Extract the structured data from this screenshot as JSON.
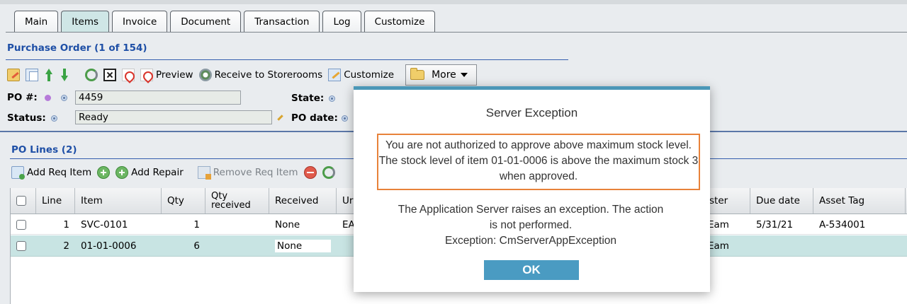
{
  "tabs": [
    {
      "label": "Main"
    },
    {
      "label": "Items",
      "active": true
    },
    {
      "label": "Invoice"
    },
    {
      "label": "Document"
    },
    {
      "label": "Transaction"
    },
    {
      "label": "Log"
    },
    {
      "label": "Customize"
    }
  ],
  "header": {
    "title": "Purchase Order (1 of 154)"
  },
  "toolbar": {
    "preview": "Preview",
    "receive": "Receive to Storerooms",
    "customize": "Customize",
    "more": "More"
  },
  "form": {
    "po_label": "PO #:",
    "po_value": "4459",
    "status_label": "Status:",
    "status_value": "Ready",
    "state_label": "State:",
    "podate_label": "PO date:"
  },
  "lines": {
    "title": "PO Lines (2)",
    "toolbar": {
      "add_req": "Add Req Item",
      "add_repair": "Add Repair",
      "remove_req": "Remove Req Item"
    },
    "columns": {
      "line": "Line",
      "item": "Item",
      "qty": "Qty",
      "qty_received_1": "Qty",
      "qty_received_2": "received",
      "received": "Received",
      "unit": "Ur",
      "requester": "ster",
      "due_date": "Due date",
      "asset_tag": "Asset Tag"
    },
    "rows": [
      {
        "line": "1",
        "item": "SVC-0101",
        "qty": "1",
        "received": "None",
        "unit": "EA",
        "requester": "Eam",
        "due_date": "5/31/21",
        "asset_tag": "A-534001"
      },
      {
        "line": "2",
        "item": "01-01-0006",
        "qty": "6",
        "received": "None",
        "unit": "",
        "requester": "Eam",
        "due_date": "",
        "asset_tag": ""
      }
    ]
  },
  "dialog": {
    "title": "Server Exception",
    "message": "You are not authorized to approve above maximum stock level. The stock level of item 01-01-0006 is above the maximum stock 3 when approved.",
    "info_line1": "The Application Server raises an exception. The action",
    "info_line2": "is not performed.",
    "info_line3": "Exception: CmServerAppException",
    "ok": "OK"
  },
  "colors": {
    "accent": "#4a97b7",
    "ok_button": "#4a9bc2",
    "highlight_border": "#e8823a",
    "section_title": "#1e4fa6",
    "selected_row": "#c8e4e3"
  }
}
